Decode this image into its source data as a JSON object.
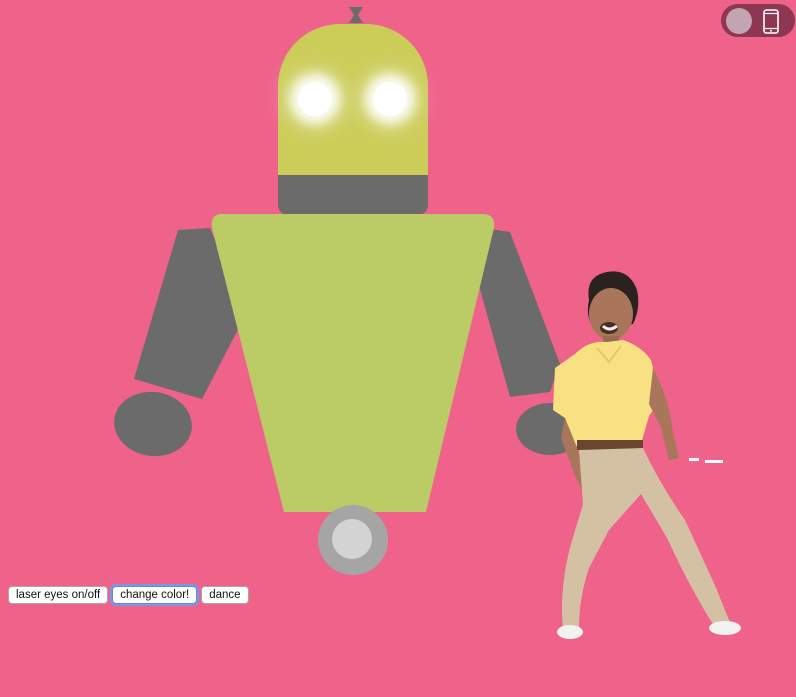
{
  "colors": {
    "background": "#ef638b",
    "robot_head": "#cccd59",
    "robot_torso": "#bbcb66",
    "robot_gray": "#6b6b6b",
    "wheel_outer": "#a5a5a5",
    "wheel_hub": "#d3d3d3",
    "toggle_bg": "#8e3752",
    "focus_ring": "#7a97e8"
  },
  "theme_toggle": {
    "state": "off",
    "icon": "smartphone-icon"
  },
  "robot": {
    "laser_eyes_on": true
  },
  "dancer": {
    "icon": "dancing-man-figure"
  },
  "controls": {
    "laser_eyes_label": "laser eyes on/off",
    "change_color_label": "change color!",
    "dance_label": "dance",
    "focused": "change_color"
  }
}
